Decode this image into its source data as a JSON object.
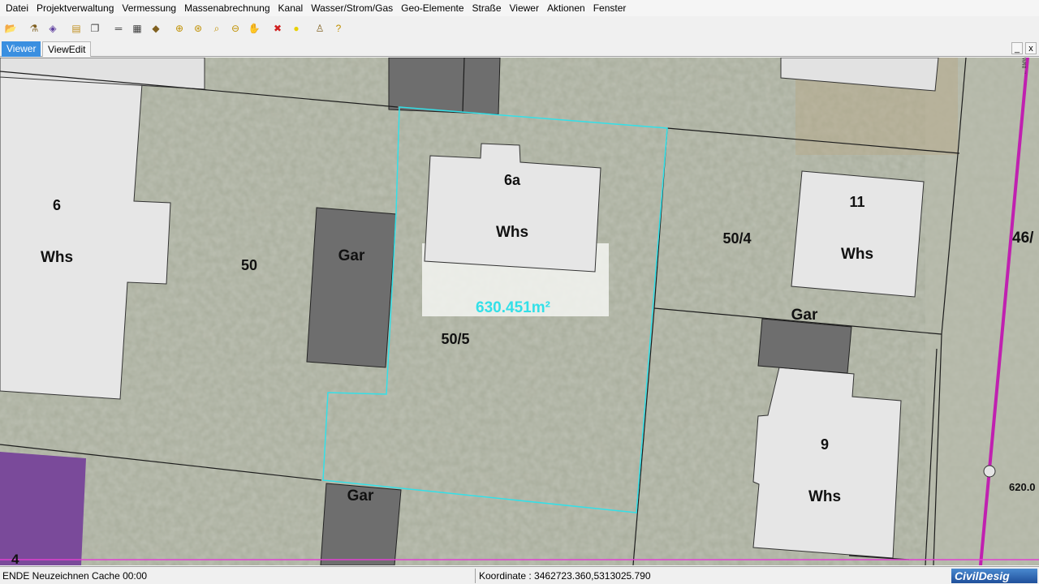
{
  "menu": [
    "Datei",
    "Projektverwaltung",
    "Vermessung",
    "Massenabrechnung",
    "Kanal",
    "Wasser/Strom/Gas",
    "Geo-Elemente",
    "Straße",
    "Viewer",
    "Aktionen",
    "Fenster"
  ],
  "toolbar": [
    {
      "icon": "open-folder-icon",
      "glyph": "📂",
      "color": "#d8a020"
    },
    {
      "icon": "filter-icon",
      "glyph": "⚗",
      "color": "#806020"
    },
    {
      "icon": "layers-icon",
      "glyph": "◈",
      "color": "#6040a0"
    },
    {
      "icon": "print-icon",
      "glyph": "▤",
      "color": "#c09020"
    },
    {
      "icon": "copy-icon",
      "glyph": "❐",
      "color": "#404040"
    },
    {
      "icon": "ruler-icon",
      "glyph": "═",
      "color": "#404040"
    },
    {
      "icon": "grid-icon",
      "glyph": "▦",
      "color": "#404040"
    },
    {
      "icon": "select-icon",
      "glyph": "◆",
      "color": "#806020"
    },
    {
      "icon": "zoom-in-icon",
      "glyph": "⊕",
      "color": "#c09000"
    },
    {
      "icon": "zoom-window-icon",
      "glyph": "⊛",
      "color": "#c09000"
    },
    {
      "icon": "zoom-fit-icon",
      "glyph": "⌕",
      "color": "#c09000"
    },
    {
      "icon": "zoom-out-icon",
      "glyph": "⊖",
      "color": "#c09000"
    },
    {
      "icon": "pan-icon",
      "glyph": "✋",
      "color": "#c09000"
    },
    {
      "icon": "delete-icon",
      "glyph": "✖",
      "color": "#d02020"
    },
    {
      "icon": "point-icon",
      "glyph": "●",
      "color": "#e8d000"
    },
    {
      "icon": "info-icon",
      "glyph": "♙",
      "color": "#806020"
    },
    {
      "icon": "help-icon",
      "glyph": "?",
      "color": "#c09000"
    }
  ],
  "tabs": [
    "Viewer",
    "ViewEdit"
  ],
  "window_buttons": {
    "minimize": "_",
    "close": "x"
  },
  "map": {
    "labels": {
      "house_6_number": "6",
      "house_6_type": "Whs",
      "parcel_50": "50",
      "garage_1": "Gar",
      "house_6a_number": "6a",
      "house_6a_type": "Whs",
      "area": "630.451m²",
      "parcel_50_5": "50/5",
      "parcel_50_4": "50/4",
      "house_11_number": "11",
      "house_11_type": "Whs",
      "garage_2": "Gar",
      "garage_3": "Gar",
      "house_9_number": "9",
      "house_9_type": "Whs",
      "parcel_46": "46/",
      "elevation": "620.0",
      "parcel_4": "4"
    },
    "colors": {
      "highlight": "#33e0e8",
      "road_line": "#c020b0",
      "building": "#e6e6e6",
      "garage": "#6e6e6e",
      "purple_parcel": "#7a4a9a"
    }
  },
  "status": {
    "left": "ENDE Neuzeichnen Cache 00:00",
    "coordinate": "Koordinate : 3462723.360,5313025.790",
    "brand": "CivilDesig"
  }
}
